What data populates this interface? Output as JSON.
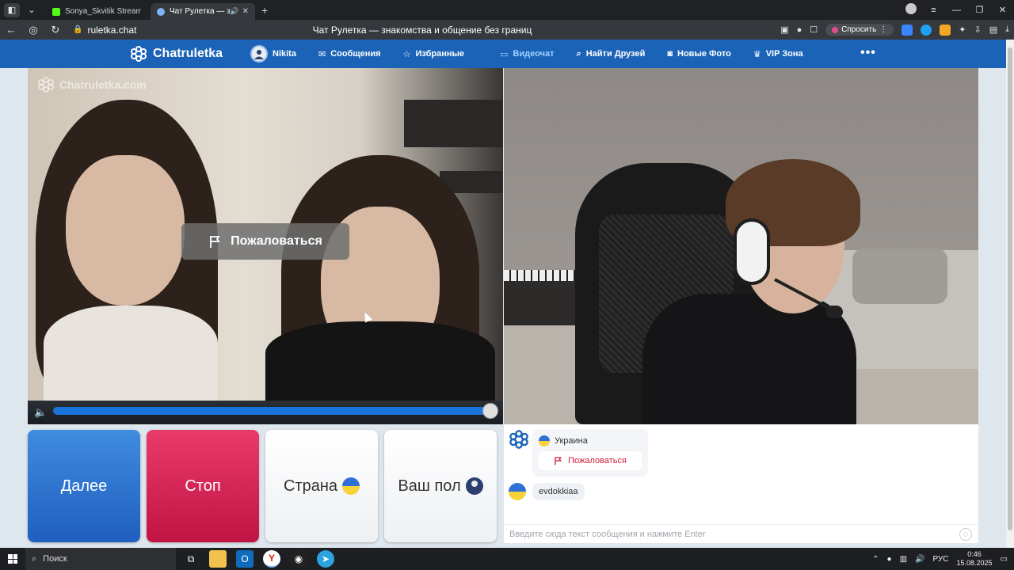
{
  "browser": {
    "tabs": [
      {
        "title": "Sonya_Skvitik Stream - Ki",
        "favicon_color": "#53fc18"
      },
      {
        "title": "Чат Рулетка — знак",
        "favicon_color": "#7fb3f2"
      }
    ],
    "url": "ruletka.chat",
    "page_title": "Чат Рулетка — знакомства и общение без границ",
    "ask_button": "Спросить"
  },
  "site": {
    "logo_text": "Chatruletka",
    "nav": {
      "user": "Nikita",
      "messages": "Сообщения",
      "favorites": "Избранные",
      "videochat": "Видеочат",
      "find_friends": "Найти Друзей",
      "new_photos": "Новые Фото",
      "vip": "VIP Зона",
      "more": "•••"
    },
    "accent_color": "#1b63b6"
  },
  "video_left": {
    "watermark": "Chatruletka.com",
    "report_label": "Пожаловаться",
    "volume_percent": 100
  },
  "buttons": {
    "next": "Далее",
    "stop": "Стоп",
    "country": "Страна",
    "gender": "Ваш пол"
  },
  "chat": {
    "country": "Украина",
    "report": "Пожаловаться",
    "message_user": "evdokkiaa",
    "input_placeholder": "Введите сюда текст сообщения и нажмите Enter"
  },
  "taskbar": {
    "search": "Поиск",
    "lang": "РУС",
    "time": "0:46",
    "date": "15.08.2025"
  }
}
